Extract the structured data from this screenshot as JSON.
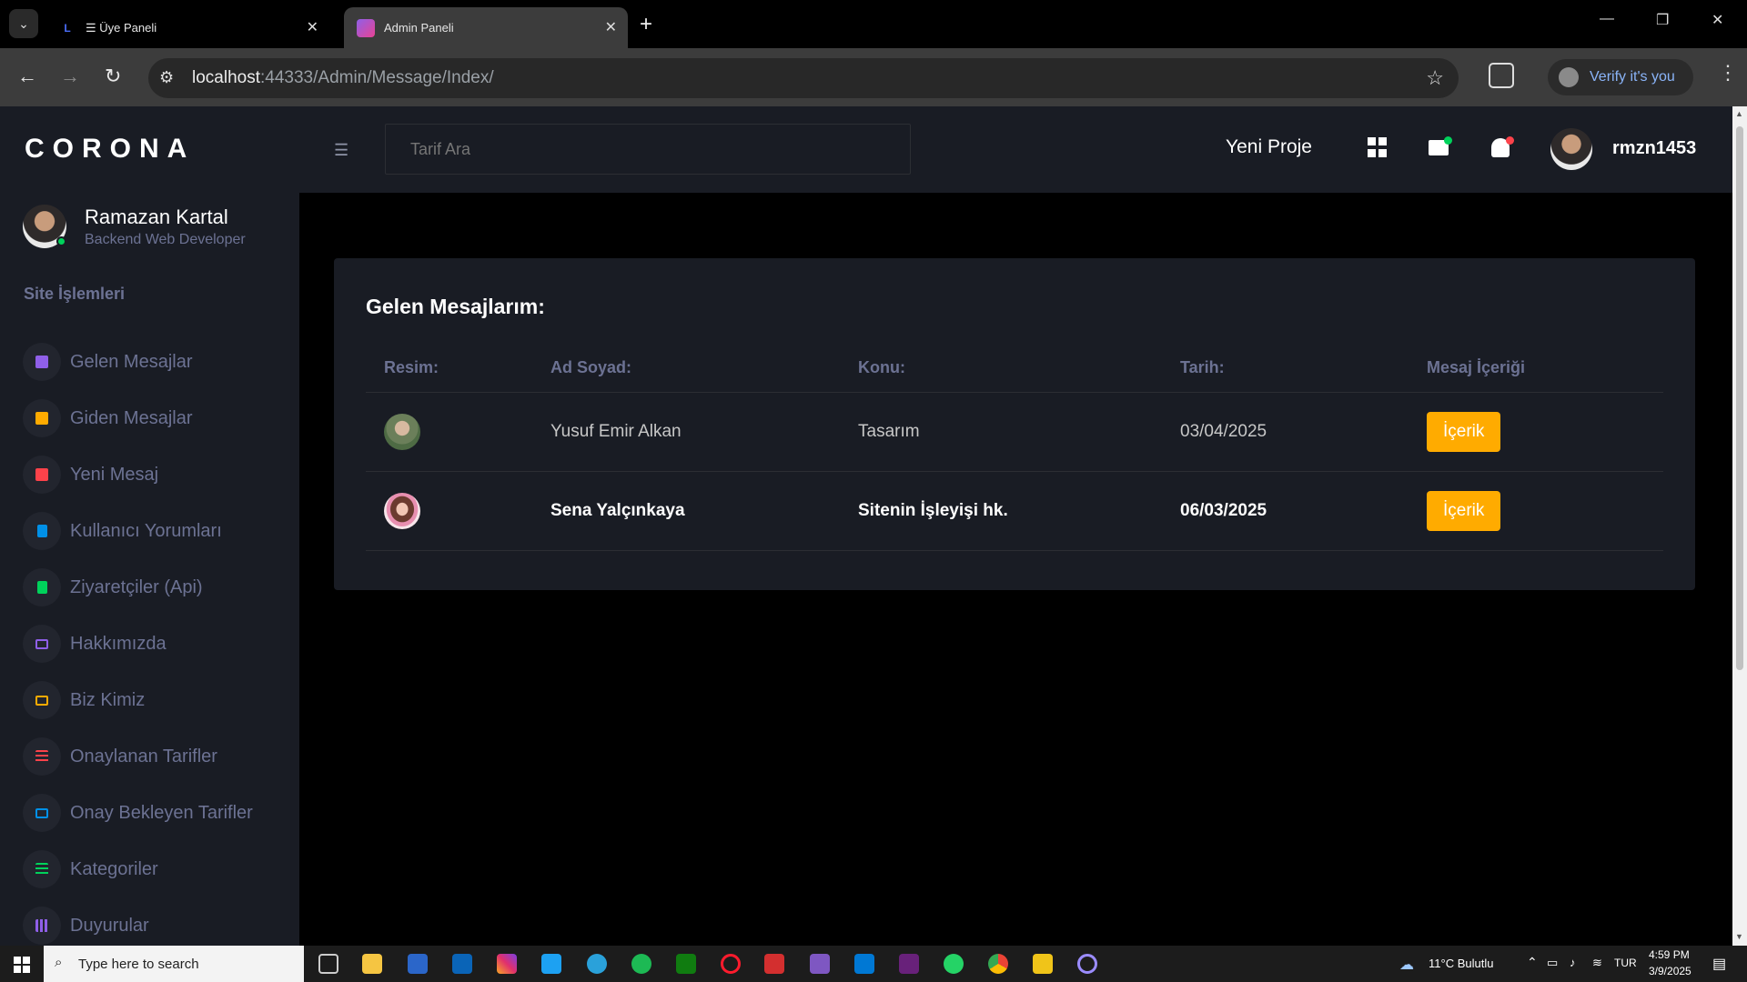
{
  "browser": {
    "tabs": [
      {
        "title": "☰ Üye Paneli",
        "active": false
      },
      {
        "title": "Admin Paneli",
        "active": true
      }
    ],
    "url_host": "localhost",
    "url_path": ":44333/Admin/Message/Index/",
    "verify_label": "Verify it's you"
  },
  "sidebar": {
    "brand": "CORONA",
    "profile_name": "Ramazan Kartal",
    "profile_role": "Backend Web Developer",
    "section_title": "Site İşlemleri",
    "items": [
      {
        "label": "Gelen Mesajlar",
        "icon": "message-icon",
        "color": "#8f5fe8"
      },
      {
        "label": "Giden Mesajlar",
        "icon": "message-icon",
        "color": "#ffab00"
      },
      {
        "label": "Yeni Mesaj",
        "icon": "message-icon",
        "color": "#fc424a"
      },
      {
        "label": "Kullanıcı Yorumları",
        "icon": "file-icon",
        "color": "#0090e7"
      },
      {
        "label": "Ziyaretçiler (Api)",
        "icon": "file-icon",
        "color": "#00d25b"
      },
      {
        "label": "Hakkımızda",
        "icon": "laptop-icon",
        "color": "#8f5fe8"
      },
      {
        "label": "Biz Kimiz",
        "icon": "laptop-icon",
        "color": "#ffab00"
      },
      {
        "label": "Onaylanan Tarifler",
        "icon": "playlist-icon",
        "color": "#fc424a"
      },
      {
        "label": "Onay Bekleyen Tarifler",
        "icon": "laptop-icon",
        "color": "#0090e7"
      },
      {
        "label": "Kategoriler",
        "icon": "playlist-icon",
        "color": "#00d25b"
      },
      {
        "label": "Duyurular",
        "icon": "table-icon",
        "color": "#8f5fe8"
      }
    ]
  },
  "topnav": {
    "search_placeholder": "Tarif Ara",
    "new_project": "Yeni Proje",
    "username": "rmzn1453"
  },
  "card": {
    "title": "Gelen Mesajlarım:",
    "columns": [
      "Resim:",
      "Ad Soyad:",
      "Konu:",
      "Tarih:",
      "Mesaj İçeriği"
    ],
    "rows": [
      {
        "name": "Yusuf Emir Alkan",
        "subject": "Tasarım",
        "date": "03/04/2025",
        "button": "İçerik",
        "read": true
      },
      {
        "name": "Sena Yalçınkaya",
        "subject": "Sitenin İşleyişi hk.",
        "date": "06/03/2025",
        "button": "İçerik",
        "read": false
      }
    ]
  },
  "taskbar": {
    "search_placeholder": "Type here to search",
    "weather": "11°C  Bulutlu",
    "lang": "TUR",
    "time": "4:59 PM",
    "date": "3/9/2025"
  },
  "colors": {
    "accent": "#ffab00",
    "sidebar_bg": "#191c24",
    "muted_text": "#6c7293"
  }
}
